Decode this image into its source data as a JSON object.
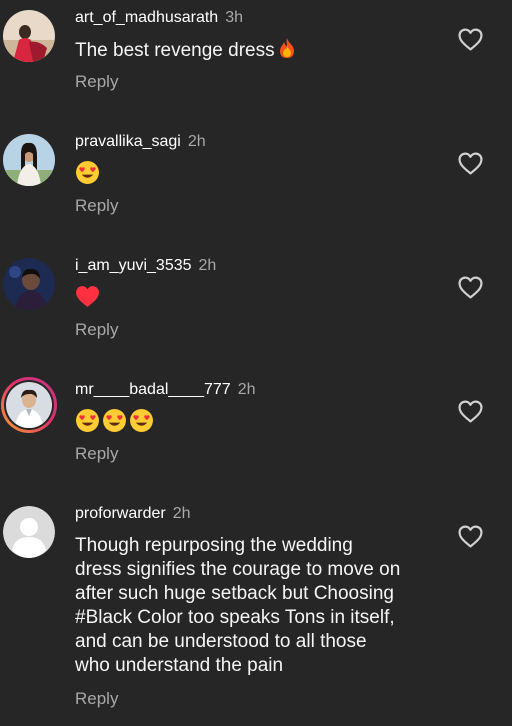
{
  "comments": [
    {
      "username": "art_of_madhusarath",
      "time": "3h",
      "text": "The best revenge dress",
      "trailing_emoji": "fire",
      "reply_label": "Reply"
    },
    {
      "username": "pravallika_sagi",
      "time": "2h",
      "emojis": [
        "heart-eyes"
      ],
      "reply_label": "Reply"
    },
    {
      "username": "i_am_yuvi_3535",
      "time": "2h",
      "emojis": [
        "red-heart"
      ],
      "reply_label": "Reply"
    },
    {
      "username": "mr____badal____777",
      "time": "2h",
      "emojis": [
        "heart-eyes",
        "heart-eyes",
        "heart-eyes"
      ],
      "reply_label": "Reply"
    },
    {
      "username": "proforwarder",
      "time": "2h",
      "text_lines": [
        "Though repurposing the wedding",
        "dress signifies the courage to move on",
        "after such huge setback but Choosing",
        "#Black Color too speaks Tons in itself,",
        "and can be understood to all those",
        "who understand the pain"
      ],
      "reply_label": "Reply"
    }
  ],
  "icons": {
    "like": "heart-outline-icon",
    "default_avatar": "default-avatar-icon"
  },
  "colors": {
    "background": "#262626",
    "secondary_text": "#a8a8a8",
    "heart_red": "#ff3040",
    "ring_gradient": [
      "#f9a22d",
      "#e1306c",
      "#c13584"
    ]
  }
}
